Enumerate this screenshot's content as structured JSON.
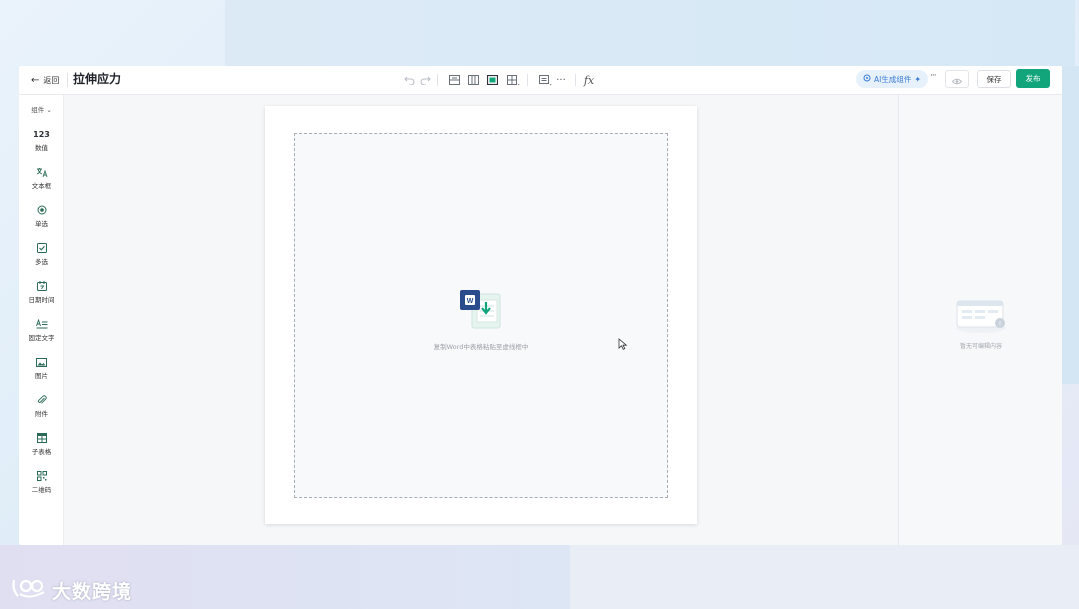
{
  "topbar": {
    "back_label": "返回",
    "title": "拉伸应力",
    "ai_label": "AI生成组件",
    "more_label": "···",
    "save_label": "保存",
    "publish_label": "发布",
    "fx_label": "fx"
  },
  "sidebar": {
    "toggle_label": "组件",
    "items": [
      {
        "icon": "123",
        "label": "数值"
      },
      {
        "icon": "text-translate-icon",
        "label": "文本框"
      },
      {
        "icon": "radio-icon",
        "label": "单选"
      },
      {
        "icon": "checkbox-icon",
        "label": "多选"
      },
      {
        "icon": "calendar-icon",
        "label": "日期时间"
      },
      {
        "icon": "fixed-text-icon",
        "label": "固定文字"
      },
      {
        "icon": "image-icon",
        "label": "图片"
      },
      {
        "icon": "paperclip-icon",
        "label": "附件"
      },
      {
        "icon": "subtable-icon",
        "label": "子表格"
      },
      {
        "icon": "qrcode-icon",
        "label": "二维码"
      }
    ]
  },
  "canvas": {
    "dropzone_hint": "复制Word中表格粘贴至虚线框中"
  },
  "right_panel": {
    "empty_text": "暂无可编辑内容"
  },
  "watermark": {
    "text": "大数跨境"
  },
  "colors": {
    "primary": "#12a57c",
    "ai_accent": "#3a7bd5",
    "word_blue": "#2b4c8c"
  }
}
